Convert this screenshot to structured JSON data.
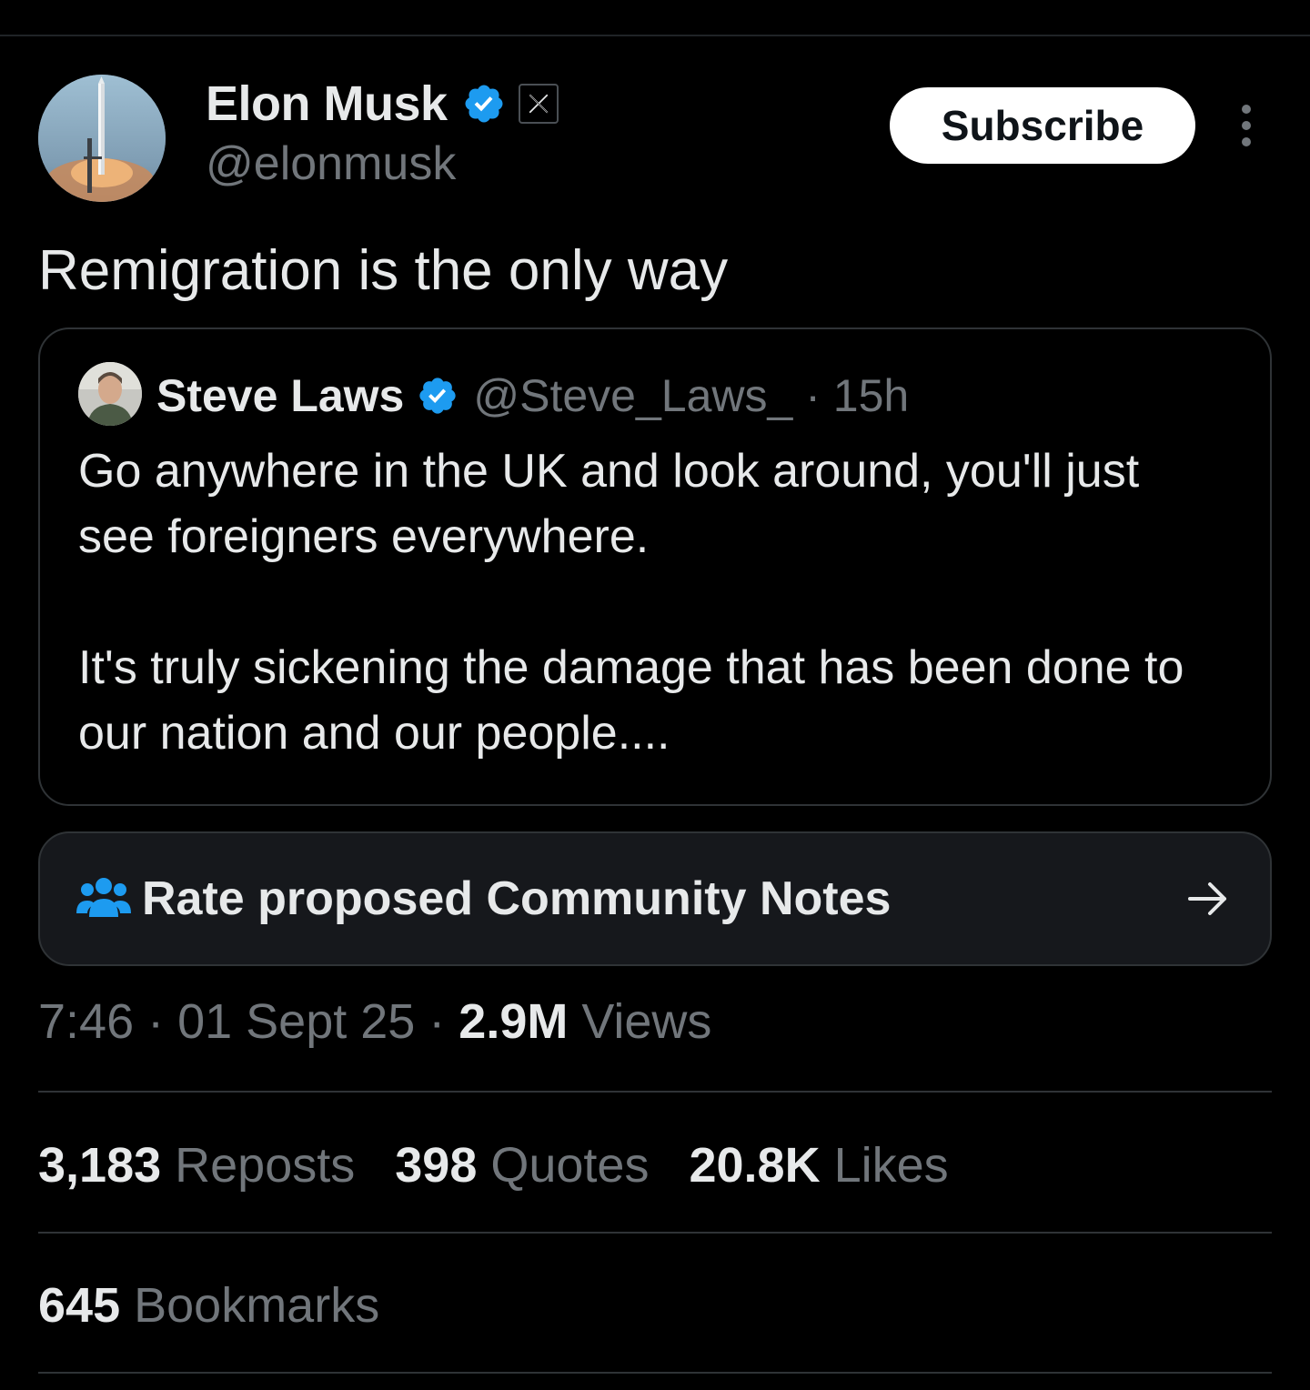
{
  "author": {
    "display_name": "Elon Musk",
    "handle": "@elonmusk",
    "avatar_icon": "rocket-launch-avatar",
    "verified_icon": "verified-badge-icon",
    "affiliate_icon": "x-logo-icon"
  },
  "header": {
    "subscribe_label": "Subscribe",
    "more_icon": "more-vertical-icon"
  },
  "tweet": {
    "text": "Remigration is the only way"
  },
  "quote": {
    "avatar_icon": "profile-photo-avatar",
    "name": "Steve Laws",
    "handle_time": "@Steve_Laws_ · 15h",
    "paragraphs": [
      "Go anywhere in the UK and look around, you'll just see foreigners everywhere.",
      "It's truly sickening the damage that has been done to our nation and our people...."
    ]
  },
  "community_notes": {
    "label": "Rate proposed Community Notes",
    "icon": "people-group-icon",
    "arrow_icon": "arrow-right-icon"
  },
  "meta": {
    "time_date": "7:46 · 01 Sept 25 · ",
    "views_count": "2.9M",
    "views_label": " Views"
  },
  "stats": {
    "reposts_count": "3,183",
    "reposts_label": " Reposts",
    "quotes_count": "398",
    "quotes_label": " Quotes",
    "likes_count": "20.8K",
    "likes_label": " Likes",
    "bookmarks_count": "645",
    "bookmarks_label": " Bookmarks"
  },
  "colors": {
    "background": "#000000",
    "text_primary": "#e7e9ea",
    "text_secondary": "#71767b",
    "border": "#2f3336",
    "verified_blue": "#1d9bf0"
  }
}
